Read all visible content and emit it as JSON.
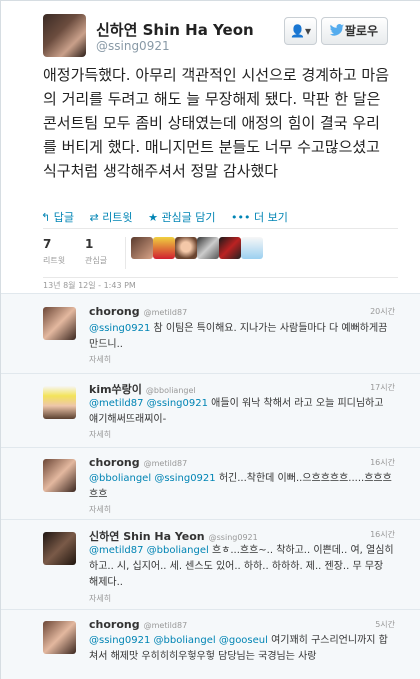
{
  "profile": {
    "display_name": "신하연 Shin Ha Yeon",
    "handle": "@ssing0921",
    "user_menu_label": "👤▾",
    "follow_label": "팔로우"
  },
  "tweet": {
    "text": "애정가득했다. 아무리 객관적인 시선으로 경계하고 마음의 거리를 두려고 해도 늘 무장해제 됐다. 막판 한 달은 콘서트팀 모두 좀비 상태였는데 애정의 힘이 결국 우리를 버티게 했다. 매니지먼트 분들도 너무 수고많으셨고 식구처럼 생각해주셔서 정말 감사했다",
    "actions": [
      {
        "icon": "reply-icon",
        "glyph": "↰",
        "label": "답글"
      },
      {
        "icon": "retweet-icon",
        "glyph": "⇄",
        "label": "리트윗"
      },
      {
        "icon": "star-icon",
        "glyph": "★",
        "label": "관심글 담기"
      },
      {
        "icon": "more-icon",
        "glyph": "•••",
        "label": "더 보기"
      }
    ],
    "stats": {
      "retweets_count": "7",
      "retweets_label": "리트윗",
      "favorites_count": "1",
      "favorites_label": "관심글"
    },
    "timestamp": "13년 8월 12일 - 1:43 PM",
    "colors": {
      "link": "#0084b4",
      "text": "#222222",
      "muted": "#999999"
    }
  },
  "replies": [
    {
      "name": "chorong",
      "handle": "@metild87",
      "time": "20시간",
      "mentions": [
        "@ssing0921"
      ],
      "text": " 참 이팀은 특이해요. 지나가는 사람들마다 다 예뻐하게끔 만드니..",
      "detail": "자세히"
    },
    {
      "name": "kim쑤랑이",
      "handle": "@bboliangel",
      "time": "17시간",
      "mentions": [
        "@metild87",
        "@ssing0921"
      ],
      "text": " 애들이 워낙 착해서 라고 오늘 피디님하고 얘기해써뜨래찌이-",
      "detail": "자세히"
    },
    {
      "name": "chorong",
      "handle": "@metild87",
      "time": "16시간",
      "mentions": [
        "@bboliangel",
        "@ssing0921"
      ],
      "text": " 허긴...착한데 이뻐..으흐흐흐흐.....흐흐흐흐흐",
      "detail": "자세히"
    },
    {
      "name": "신하연 Shin Ha Yeon",
      "handle": "@ssing0921",
      "time": "16시간",
      "mentions": [
        "@metild87",
        "@bboliangel"
      ],
      "text": " 흐ㅎ...흐흐~.. 착하고.. 이쁜데.. 여, 열심히 하고.. 시, 십지어..   세. 센스도 있어.. 하하.. 하하하. 제.. 젠장.. 무 무장 해제다..",
      "detail": "자세히"
    },
    {
      "name": "chorong",
      "handle": "@metild87",
      "time": "5시간",
      "mentions": [
        "@ssing0921",
        "@bboliangel",
        "@gooseul"
      ],
      "text": " 여기꽤히 구스리언니까지 합쳐서 해제맛 우히히히우헣우헣 담당님는 국경님는 사랑",
      "detail": "자세히"
    }
  ]
}
